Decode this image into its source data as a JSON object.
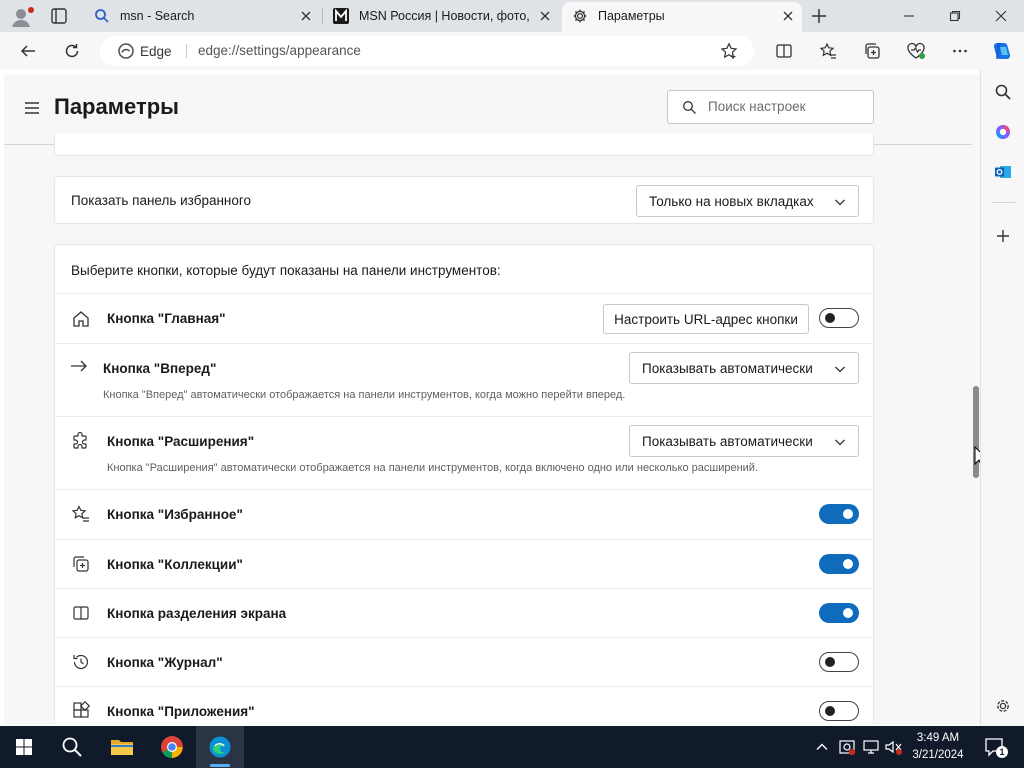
{
  "browser": {
    "tabs": [
      {
        "title": "msn - Search",
        "active": false
      },
      {
        "title": "MSN Россия | Новости, фото, п",
        "active": false
      },
      {
        "title": "Параметры",
        "active": true
      }
    ],
    "address": {
      "site_label": "Edge",
      "url": "edge://settings/appearance"
    }
  },
  "page": {
    "title": "Параметры",
    "search_placeholder": "Поиск настроек"
  },
  "favorites_bar": {
    "label": "Показать панель избранного",
    "value": "Только на новых вкладках"
  },
  "toolbar_section": {
    "heading": "Выберите кнопки, которые будут показаны на панели инструментов:",
    "rows": [
      {
        "label": "Кнопка \"Главная\"",
        "icon": "home-icon",
        "button": "Настроить URL-адрес кнопки",
        "toggle": false
      },
      {
        "label": "Кнопка \"Вперед\"",
        "icon": "forward-arrow-icon",
        "dropdown": "Показывать автоматически",
        "desc": "Кнопка \"Вперед\" автоматически отображается на панели инструментов, когда можно перейти вперед."
      },
      {
        "label": "Кнопка \"Расширения\"",
        "icon": "extensions-icon",
        "dropdown": "Показывать автоматически",
        "desc": "Кнопка \"Расширения\" автоматически отображается на панели инструментов, когда включено одно или несколько расширений."
      },
      {
        "label": "Кнопка \"Избранное\"",
        "icon": "favorites-icon",
        "toggle": true
      },
      {
        "label": "Кнопка \"Коллекции\"",
        "icon": "collections-icon",
        "toggle": true
      },
      {
        "label": "Кнопка разделения экрана",
        "icon": "split-screen-icon",
        "toggle": true
      },
      {
        "label": "Кнопка \"Журнал\"",
        "icon": "history-icon",
        "toggle": false
      },
      {
        "label": "Кнопка \"Приложения\"",
        "icon": "apps-icon",
        "toggle": false
      }
    ]
  },
  "taskbar": {
    "time": "3:49 AM",
    "date": "3/21/2024",
    "notification_count": "1"
  },
  "colors": {
    "accent": "#0f6cbd",
    "taskbar": "#101a2a",
    "tabstrip": "#dfe3e8"
  }
}
